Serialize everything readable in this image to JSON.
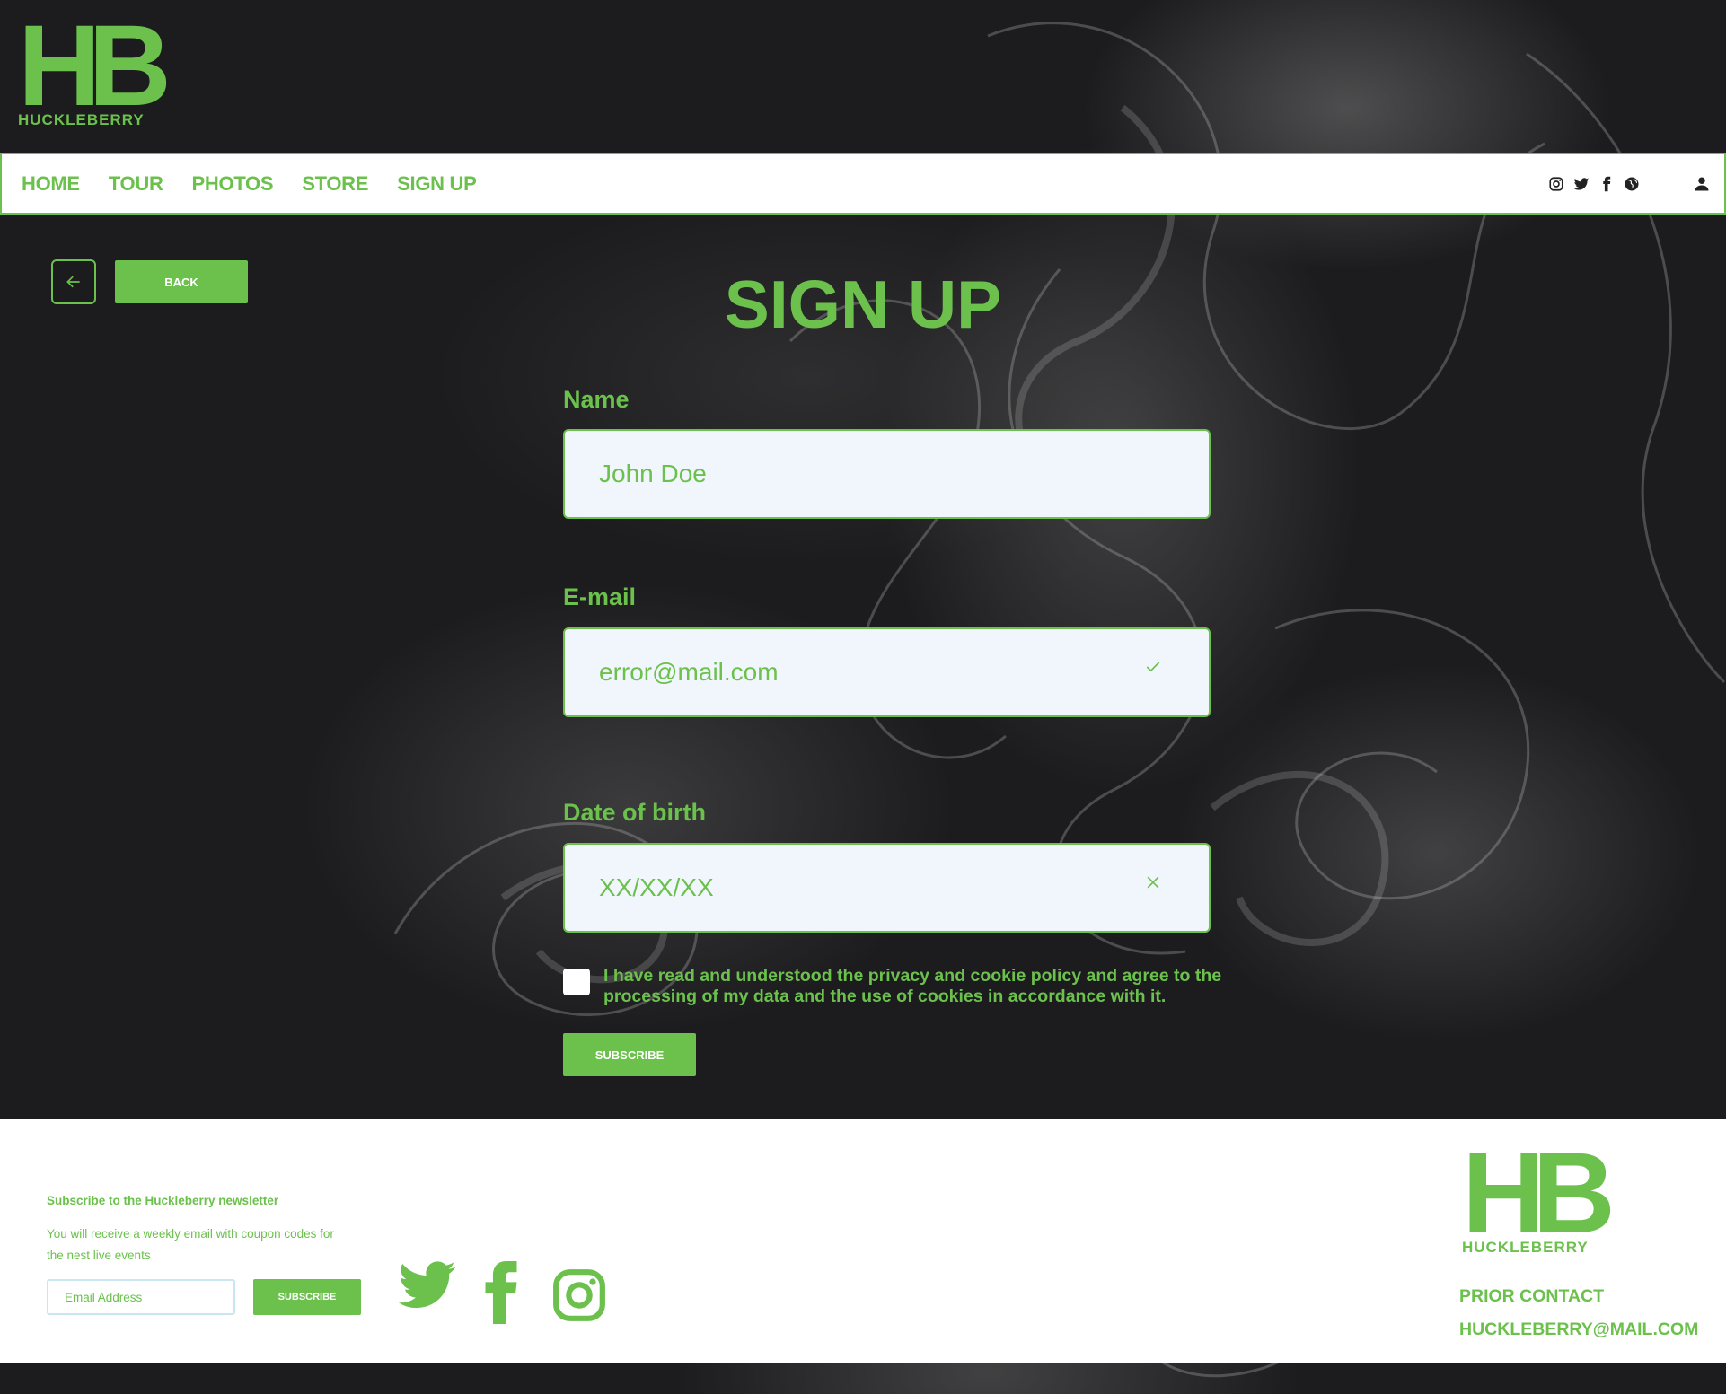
{
  "brand": {
    "logo_letters_h": "H",
    "logo_letters_b": "B",
    "logo_word": "HUCKLEBERRY",
    "accent_color": "#6bc14c"
  },
  "nav": {
    "items": [
      {
        "label": "HOME"
      },
      {
        "label": "TOUR"
      },
      {
        "label": "PHOTOS"
      },
      {
        "label": "STORE"
      },
      {
        "label": "SIGN UP"
      }
    ],
    "icons": [
      "instagram-icon",
      "twitter-icon",
      "facebook-icon",
      "globe-icon",
      "user-icon"
    ]
  },
  "back": {
    "label": "BACK"
  },
  "form": {
    "title": "SIGN UP",
    "name_label": "Name",
    "name_value": "John Doe",
    "email_label": "E-mail",
    "email_value": "error@mail.com",
    "dob_label": "Date of birth",
    "dob_value": "XX/XX/XX",
    "consent_text": "I have read and understood the privacy and cookie policy and agree to the processing of my data and the use of cookies in accordance with it.",
    "submit_label": "SUBSCRIBE"
  },
  "footer": {
    "newsletter_title": "Subscribe to the Huckleberry newsletter",
    "newsletter_desc": "You will receive a weekly email with coupon codes for the nest live events",
    "email_placeholder": "Email Address",
    "subscribe_label": "SUBSCRIBE",
    "social_icons": [
      "twitter-icon",
      "facebook-icon",
      "instagram-icon"
    ],
    "contact_label": "PRIOR CONTACT",
    "contact_email": "HUCKLEBERRY@MAIL.COM"
  }
}
